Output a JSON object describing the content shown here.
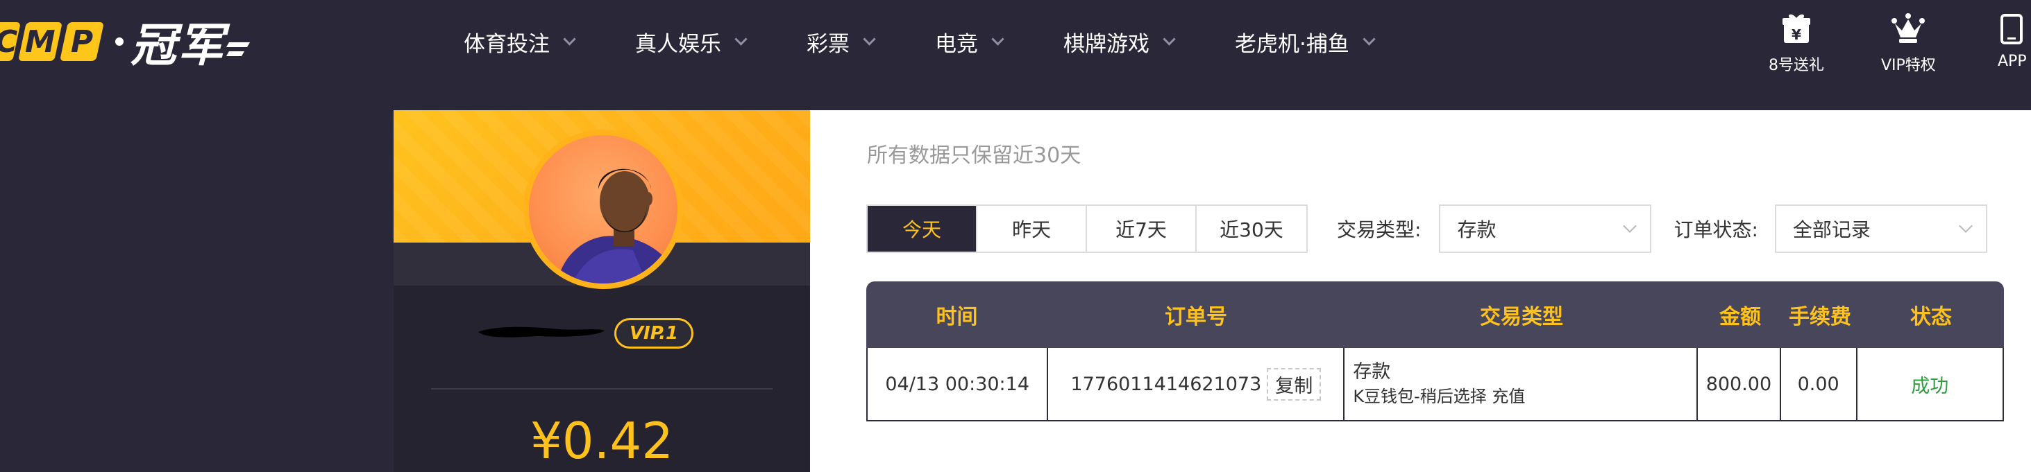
{
  "logo": {
    "letters": [
      "C",
      "M",
      "P"
    ],
    "brand_cn": "冠军"
  },
  "nav": {
    "items": [
      {
        "label": "体育投注"
      },
      {
        "label": "真人娱乐"
      },
      {
        "label": "彩票"
      },
      {
        "label": "电竞"
      },
      {
        "label": "棋牌游戏"
      },
      {
        "label": "老虎机·捕鱼"
      }
    ],
    "quick": [
      {
        "label": "8号送礼",
        "icon": "gift-yen-icon"
      },
      {
        "label": "VIP特权",
        "icon": "crown-icon"
      },
      {
        "label": "APP",
        "icon": "phone-icon"
      }
    ]
  },
  "profile": {
    "vip_label": "VIP.1",
    "balance": "¥0.42"
  },
  "main": {
    "subtitle": "所有数据只保留近30天",
    "date_tabs": [
      {
        "label": "今天",
        "active": true
      },
      {
        "label": "昨天",
        "active": false
      },
      {
        "label": "近7天",
        "active": false
      },
      {
        "label": "近30天",
        "active": false
      }
    ],
    "type_filter": {
      "label": "交易类型:",
      "value": "存款"
    },
    "status_filter": {
      "label": "订单状态:",
      "value": "全部记录"
    },
    "table": {
      "headers": [
        "时间",
        "订单号",
        "交易类型",
        "金额",
        "手续费",
        "状态"
      ],
      "rows": [
        {
          "time": "04/13 00:30:14",
          "order_no": "1776011414621073",
          "copy_label": "复制",
          "type_main": "存款",
          "type_detail": "K豆钱包-稍后选择 充值",
          "amount": "800.00",
          "fee": "0.00",
          "status": "成功"
        }
      ]
    }
  },
  "colors": {
    "nav_bg": "#2a2838",
    "accent_yellow": "#ffc21c",
    "table_header_bg": "#48465a",
    "success_green": "#2e9e3f"
  }
}
